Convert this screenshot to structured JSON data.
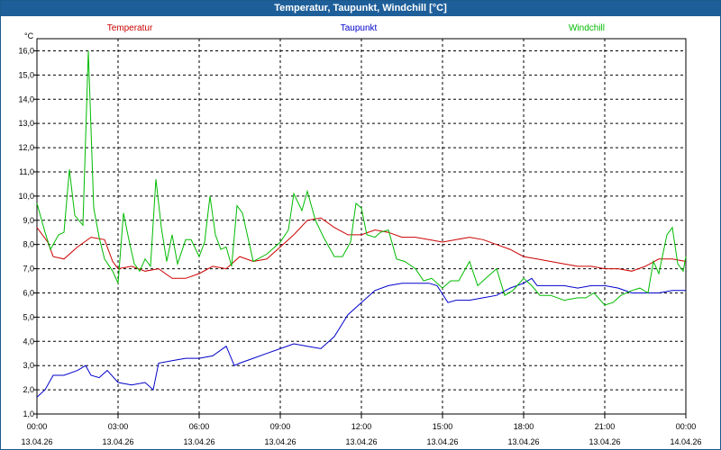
{
  "window": {
    "title": "Temperatur, Taupunkt, Windchill [°C]"
  },
  "chart_data": {
    "type": "line",
    "title": "Temperatur, Taupunkt, Windchill [°C]",
    "ylabel": "°C",
    "ylim": [
      1.0,
      16.5
    ],
    "y_ticks": [
      "1,0",
      "2,0",
      "3,0",
      "4,0",
      "5,0",
      "6,0",
      "7,0",
      "8,0",
      "9,0",
      "10,0",
      "11,0",
      "12,0",
      "13,0",
      "14,0",
      "15,0",
      "16,0"
    ],
    "x_range_hours": [
      0,
      24
    ],
    "x_ticks": [
      {
        "time": "00:00",
        "date": "13.04.26"
      },
      {
        "time": "03:00",
        "date": "13.04.26"
      },
      {
        "time": "06:00",
        "date": "13.04.26"
      },
      {
        "time": "09:00",
        "date": "13.04.26"
      },
      {
        "time": "12:00",
        "date": "13.04.26"
      },
      {
        "time": "15:00",
        "date": "13.04.26"
      },
      {
        "time": "18:00",
        "date": "13.04.26"
      },
      {
        "time": "21:00",
        "date": "13.04.26"
      },
      {
        "time": "00:00",
        "date": "14.04.26"
      }
    ],
    "grid": true,
    "legend_placement": "top",
    "series": [
      {
        "name": "Temperatur",
        "color": "#cc0000",
        "points": [
          [
            0.0,
            8.7
          ],
          [
            0.4,
            8.1
          ],
          [
            0.6,
            7.5
          ],
          [
            1.0,
            7.4
          ],
          [
            1.5,
            7.9
          ],
          [
            2.0,
            8.3
          ],
          [
            2.5,
            8.2
          ],
          [
            2.8,
            7.3
          ],
          [
            3.0,
            7.0
          ],
          [
            3.5,
            7.1
          ],
          [
            4.0,
            6.9
          ],
          [
            4.5,
            7.0
          ],
          [
            5.0,
            6.6
          ],
          [
            5.5,
            6.6
          ],
          [
            6.0,
            6.8
          ],
          [
            6.5,
            7.1
          ],
          [
            7.0,
            7.0
          ],
          [
            7.5,
            7.5
          ],
          [
            8.0,
            7.3
          ],
          [
            8.5,
            7.4
          ],
          [
            9.0,
            7.9
          ],
          [
            9.5,
            8.4
          ],
          [
            10.0,
            9.0
          ],
          [
            10.5,
            9.1
          ],
          [
            11.0,
            8.7
          ],
          [
            11.5,
            8.4
          ],
          [
            12.0,
            8.4
          ],
          [
            12.5,
            8.6
          ],
          [
            13.0,
            8.5
          ],
          [
            13.5,
            8.3
          ],
          [
            14.0,
            8.3
          ],
          [
            14.5,
            8.2
          ],
          [
            15.0,
            8.1
          ],
          [
            15.5,
            8.2
          ],
          [
            16.0,
            8.3
          ],
          [
            16.5,
            8.2
          ],
          [
            17.0,
            8.0
          ],
          [
            17.5,
            7.8
          ],
          [
            18.0,
            7.5
          ],
          [
            18.5,
            7.4
          ],
          [
            19.0,
            7.3
          ],
          [
            19.5,
            7.2
          ],
          [
            20.0,
            7.1
          ],
          [
            20.5,
            7.1
          ],
          [
            21.0,
            7.0
          ],
          [
            21.5,
            7.0
          ],
          [
            22.0,
            6.9
          ],
          [
            22.5,
            7.1
          ],
          [
            23.0,
            7.4
          ],
          [
            23.5,
            7.4
          ],
          [
            24.0,
            7.3
          ]
        ]
      },
      {
        "name": "Taupunkt",
        "color": "#0000cc",
        "points": [
          [
            0.0,
            1.7
          ],
          [
            0.3,
            2.0
          ],
          [
            0.6,
            2.6
          ],
          [
            1.0,
            2.6
          ],
          [
            1.5,
            2.8
          ],
          [
            1.8,
            3.0
          ],
          [
            2.0,
            2.6
          ],
          [
            2.3,
            2.5
          ],
          [
            2.6,
            2.8
          ],
          [
            3.0,
            2.3
          ],
          [
            3.5,
            2.2
          ],
          [
            4.0,
            2.3
          ],
          [
            4.3,
            2.0
          ],
          [
            4.5,
            3.1
          ],
          [
            5.0,
            3.2
          ],
          [
            5.5,
            3.3
          ],
          [
            6.0,
            3.3
          ],
          [
            6.5,
            3.4
          ],
          [
            7.0,
            3.8
          ],
          [
            7.3,
            3.0
          ],
          [
            7.5,
            3.1
          ],
          [
            8.0,
            3.3
          ],
          [
            8.5,
            3.5
          ],
          [
            9.0,
            3.7
          ],
          [
            9.5,
            3.9
          ],
          [
            10.0,
            3.8
          ],
          [
            10.5,
            3.7
          ],
          [
            11.0,
            4.2
          ],
          [
            11.5,
            5.1
          ],
          [
            12.0,
            5.6
          ],
          [
            12.5,
            6.1
          ],
          [
            13.0,
            6.3
          ],
          [
            13.5,
            6.4
          ],
          [
            14.0,
            6.4
          ],
          [
            14.5,
            6.4
          ],
          [
            14.8,
            6.3
          ],
          [
            15.2,
            5.6
          ],
          [
            15.5,
            5.7
          ],
          [
            16.0,
            5.7
          ],
          [
            16.5,
            5.8
          ],
          [
            17.0,
            5.9
          ],
          [
            17.5,
            6.2
          ],
          [
            18.0,
            6.4
          ],
          [
            18.3,
            6.6
          ],
          [
            18.5,
            6.3
          ],
          [
            19.0,
            6.3
          ],
          [
            19.5,
            6.3
          ],
          [
            20.0,
            6.2
          ],
          [
            20.5,
            6.3
          ],
          [
            21.0,
            6.3
          ],
          [
            21.5,
            6.2
          ],
          [
            22.0,
            6.0
          ],
          [
            22.5,
            6.0
          ],
          [
            23.0,
            6.0
          ],
          [
            23.5,
            6.1
          ],
          [
            24.0,
            6.1
          ]
        ]
      },
      {
        "name": "Windchill",
        "color": "#00bb00",
        "points": [
          [
            0.0,
            9.7
          ],
          [
            0.3,
            8.5
          ],
          [
            0.5,
            7.8
          ],
          [
            0.8,
            8.4
          ],
          [
            1.0,
            8.5
          ],
          [
            1.2,
            11.1
          ],
          [
            1.4,
            9.2
          ],
          [
            1.7,
            8.8
          ],
          [
            1.9,
            16.0
          ],
          [
            2.1,
            9.5
          ],
          [
            2.3,
            8.3
          ],
          [
            2.5,
            7.4
          ],
          [
            2.8,
            6.9
          ],
          [
            3.0,
            6.4
          ],
          [
            3.2,
            9.3
          ],
          [
            3.4,
            8.2
          ],
          [
            3.6,
            7.2
          ],
          [
            3.8,
            6.9
          ],
          [
            4.0,
            7.4
          ],
          [
            4.2,
            7.1
          ],
          [
            4.4,
            10.7
          ],
          [
            4.6,
            8.7
          ],
          [
            4.8,
            7.3
          ],
          [
            5.0,
            8.4
          ],
          [
            5.2,
            7.2
          ],
          [
            5.5,
            8.2
          ],
          [
            5.7,
            8.2
          ],
          [
            6.0,
            7.5
          ],
          [
            6.2,
            8.1
          ],
          [
            6.4,
            10.0
          ],
          [
            6.6,
            8.4
          ],
          [
            6.8,
            7.8
          ],
          [
            7.0,
            7.9
          ],
          [
            7.2,
            7.1
          ],
          [
            7.4,
            9.6
          ],
          [
            7.6,
            9.3
          ],
          [
            7.8,
            8.3
          ],
          [
            8.0,
            7.3
          ],
          [
            8.5,
            7.6
          ],
          [
            9.0,
            8.1
          ],
          [
            9.3,
            8.6
          ],
          [
            9.5,
            10.1
          ],
          [
            9.8,
            9.4
          ],
          [
            10.0,
            10.2
          ],
          [
            10.3,
            9.0
          ],
          [
            10.6,
            8.3
          ],
          [
            11.0,
            7.5
          ],
          [
            11.3,
            7.5
          ],
          [
            11.6,
            8.1
          ],
          [
            11.8,
            9.7
          ],
          [
            12.0,
            9.5
          ],
          [
            12.2,
            8.4
          ],
          [
            12.5,
            8.3
          ],
          [
            12.7,
            8.5
          ],
          [
            13.0,
            8.6
          ],
          [
            13.3,
            7.4
          ],
          [
            13.6,
            7.3
          ],
          [
            14.0,
            7.0
          ],
          [
            14.3,
            6.5
          ],
          [
            14.6,
            6.6
          ],
          [
            15.0,
            6.2
          ],
          [
            15.3,
            6.5
          ],
          [
            15.6,
            6.5
          ],
          [
            16.0,
            7.3
          ],
          [
            16.3,
            6.3
          ],
          [
            16.6,
            6.6
          ],
          [
            17.0,
            7.0
          ],
          [
            17.3,
            5.9
          ],
          [
            17.6,
            6.1
          ],
          [
            18.0,
            6.6
          ],
          [
            18.3,
            6.3
          ],
          [
            18.6,
            5.9
          ],
          [
            19.0,
            5.9
          ],
          [
            19.5,
            5.7
          ],
          [
            20.0,
            5.8
          ],
          [
            20.3,
            5.8
          ],
          [
            20.6,
            6.0
          ],
          [
            21.0,
            5.5
          ],
          [
            21.3,
            5.6
          ],
          [
            21.6,
            5.9
          ],
          [
            22.0,
            6.1
          ],
          [
            22.3,
            6.2
          ],
          [
            22.6,
            6.0
          ],
          [
            22.8,
            7.3
          ],
          [
            23.0,
            6.8
          ],
          [
            23.3,
            8.4
          ],
          [
            23.5,
            8.7
          ],
          [
            23.7,
            7.2
          ],
          [
            23.9,
            6.9
          ],
          [
            24.0,
            7.5
          ]
        ]
      }
    ]
  }
}
